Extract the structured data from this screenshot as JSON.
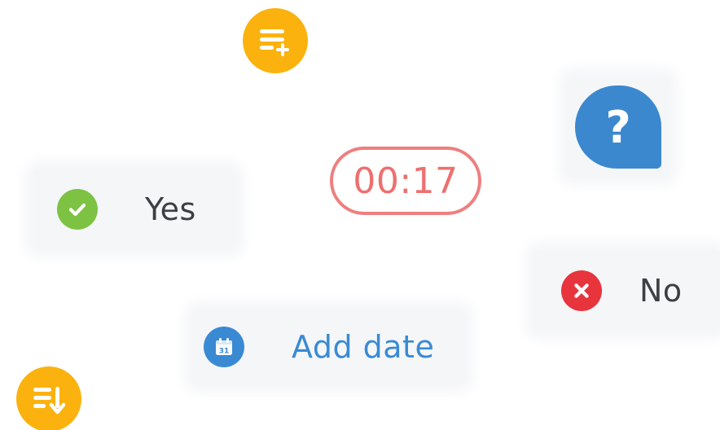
{
  "colors": {
    "orange": "#fbb20f",
    "yes_green": "#7dc242",
    "no_red": "#e8343c",
    "accent_blue": "#3a8ad3",
    "timer_red": "#ee6f6f",
    "text_dark": "#3d3f42"
  },
  "icons": {
    "add_list": "playlist-add-icon",
    "sort": "sort-descending-icon",
    "yes": "check-circle-icon",
    "no": "x-circle-icon",
    "calendar": "calendar-icon",
    "help": "question-bubble-icon"
  },
  "help": {
    "glyph": "?"
  },
  "timer": {
    "value": "00:17"
  },
  "yes_option": {
    "label": "Yes"
  },
  "no_option": {
    "label": "No"
  },
  "date_action": {
    "label": "Add date",
    "calendar_day": "31"
  }
}
